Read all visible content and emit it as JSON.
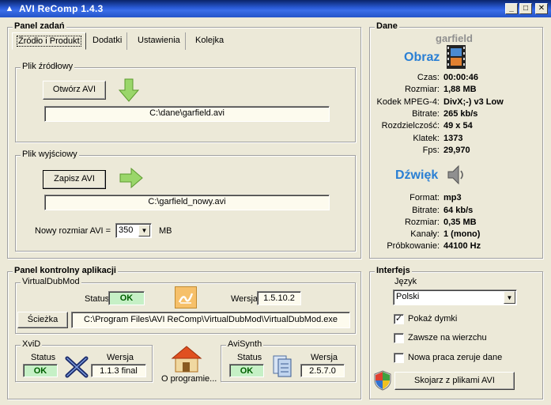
{
  "window": {
    "title": "AVI ReComp  1.4.3",
    "buttons": {
      "minimize": "_",
      "maximize": "□",
      "close": "✕"
    }
  },
  "tasks": {
    "title": "Panel zadań",
    "tabs": [
      "Źródło i Produkt",
      "Dodatki",
      "Ustawienia",
      "Kolejka"
    ],
    "source": {
      "legend": "Plik źródłowy",
      "open_button": "Otwórz AVI",
      "path": "C:\\dane\\garfield.avi"
    },
    "output": {
      "legend": "Plik wyjściowy",
      "save_button": "Zapisz AVI",
      "path": "C:\\garfield_nowy.avi",
      "size_label": "Nowy rozmiar AVI =",
      "size_value": "350",
      "size_unit": "MB"
    }
  },
  "control": {
    "title": "Panel kontrolny aplikacji",
    "vdm": {
      "legend": "VirtualDubMod",
      "status_label": "Status",
      "status": "OK",
      "version_label": "Wersja",
      "version": "1.5.10.2",
      "path_button": "Ścieżka",
      "path": "C:\\Program Files\\AVI ReComp\\VirtualDubMod\\VirtualDubMod.exe"
    },
    "xvid": {
      "legend": "XviD",
      "status_label": "Status",
      "status": "OK",
      "version_label": "Wersja",
      "version": "1.1.3 final"
    },
    "about_label": "O programie...",
    "avisynth": {
      "legend": "AviSynth",
      "status_label": "Status",
      "status": "OK",
      "version_label": "Wersja",
      "version": "2.5.7.0"
    }
  },
  "data": {
    "title": "Dane",
    "file_name": "garfield",
    "video_title": "Obraz",
    "video": [
      {
        "label": "Czas:",
        "value": "00:00:46"
      },
      {
        "label": "Rozmiar:",
        "value": "1,88 MB"
      },
      {
        "label": "Kodek MPEG-4:",
        "value": "DivX;-) v3 Low"
      },
      {
        "label": "Bitrate:",
        "value": "265 kb/s"
      },
      {
        "label": "Rozdzielczość:",
        "value": "49 x 54"
      },
      {
        "label": "Klatek:",
        "value": "1373"
      },
      {
        "label": "Fps:",
        "value": "29,970"
      }
    ],
    "audio_title": "Dźwięk",
    "audio": [
      {
        "label": "Format:",
        "value": "mp3"
      },
      {
        "label": "Bitrate:",
        "value": "64 kb/s"
      },
      {
        "label": "Rozmiar:",
        "value": "0,35 MB"
      },
      {
        "label": "Kanały:",
        "value": "1 (mono)"
      },
      {
        "label": "Próbkowanie:",
        "value": "44100 Hz"
      }
    ]
  },
  "interface": {
    "title": "Interfejs",
    "language_label": "Język",
    "language": "Polski",
    "options": [
      {
        "label": "Pokaż dymki",
        "checked": true
      },
      {
        "label": "Zawsze na wierzchu",
        "checked": false
      },
      {
        "label": "Nowa praca zeruje dane",
        "checked": false
      }
    ],
    "associate_button": "Skojarz z plikami AVI"
  },
  "colors": {
    "titlebar": "#0a246a",
    "ok_green": "#c6f0c6",
    "accent_blue": "#2a7fd4",
    "field_bg": "#fdfbee"
  }
}
